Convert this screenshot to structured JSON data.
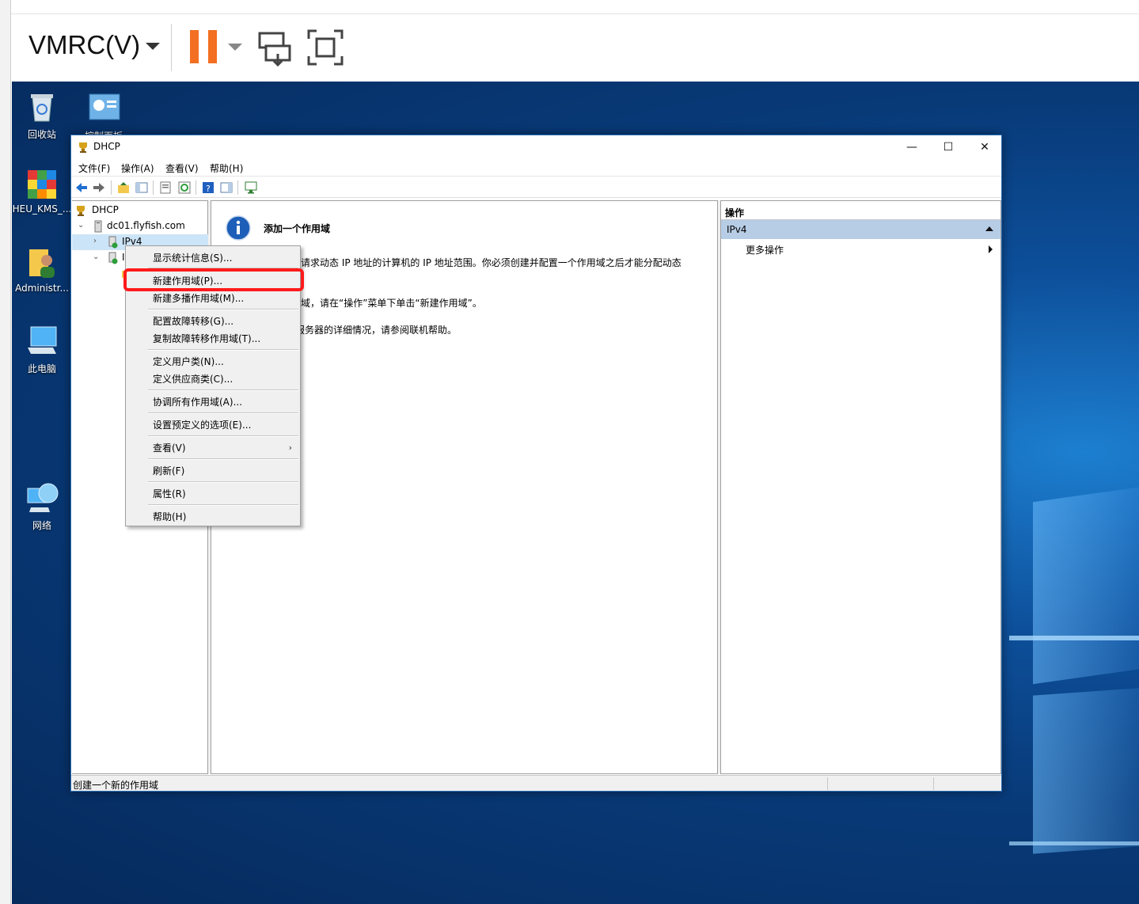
{
  "vmrc": {
    "menu_label": "VMRC(V)",
    "pause_color": "#f36f21"
  },
  "desktop": {
    "icons": [
      {
        "name": "recycle-bin",
        "label": "回收站",
        "icon": "recycle-bin-icon"
      },
      {
        "name": "control-panel",
        "label": "控制面板",
        "icon": "control-panel-icon"
      },
      {
        "name": "heu-kms",
        "label": "HEU_KMS_...",
        "icon": "rubiks-cube-icon"
      },
      {
        "name": "administrator",
        "label": "Administr...",
        "icon": "user-folder-icon"
      },
      {
        "name": "this-pc",
        "label": "此电脑",
        "icon": "computer-icon"
      },
      {
        "name": "network",
        "label": "网络",
        "icon": "network-icon"
      }
    ]
  },
  "window": {
    "title": "DHCP",
    "minimize": "—",
    "maximize": "☐",
    "close": "✕",
    "menu": [
      "文件(F)",
      "操作(A)",
      "查看(V)",
      "帮助(H)"
    ]
  },
  "tree": {
    "root": "DHCP",
    "server": "dc01.flyfish.com",
    "ipv4": "IPv4",
    "ipv6_partial": "I"
  },
  "center": {
    "title": "添加一个作用域",
    "lines": [
      "请求动态 IP 地址的计算机的 IP 地址范围。你必须创建并配置一个作用域之后才能分配动态",
      "域，请在“操作”菜单下单击“新建作用域”。",
      "服务器的详细情况，请参阅联机帮助。"
    ]
  },
  "actions": {
    "header": "操作",
    "section": "IPv4",
    "more": "更多操作"
  },
  "context_menu": {
    "items": [
      "显示统计信息(S)...",
      "新建作用域(P)...",
      "新建多播作用域(M)...",
      "配置故障转移(G)...",
      "复制故障转移作用域(T)...",
      "定义用户类(N)...",
      "定义供应商类(C)...",
      "协调所有作用域(A)...",
      "设置预定义的选项(E)...",
      "查看(V)",
      "刷新(F)",
      "属性(R)",
      "帮助(H)"
    ],
    "submenu_arrow": "›"
  },
  "status": {
    "text": "创建一个新的作用域"
  }
}
